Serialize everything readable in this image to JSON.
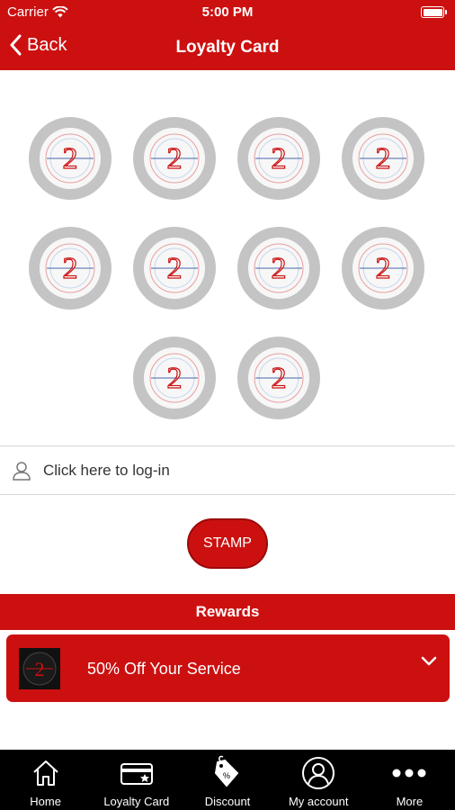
{
  "status_bar": {
    "carrier": "Carrier",
    "time": "5:00 PM"
  },
  "nav": {
    "back_label": "Back",
    "title": "Loyalty Card"
  },
  "stamps": {
    "total": 10,
    "collected": 0,
    "stamp_text": "2",
    "brand_color": "#cc1010",
    "stamp_color": "#c4c4c4"
  },
  "login": {
    "label": "Click here to log-in"
  },
  "stamp_button": {
    "label": "STAMP"
  },
  "rewards": {
    "header": "Rewards",
    "items": [
      {
        "title": "50% Off Your Service"
      }
    ]
  },
  "tabs": [
    {
      "label": "Home",
      "icon": "home-icon"
    },
    {
      "label": "Loyalty Card",
      "icon": "loyalty-card-icon"
    },
    {
      "label": "Discount",
      "icon": "discount-tag-icon"
    },
    {
      "label": "My account",
      "icon": "account-icon"
    },
    {
      "label": "More",
      "icon": "more-dots-icon"
    }
  ]
}
